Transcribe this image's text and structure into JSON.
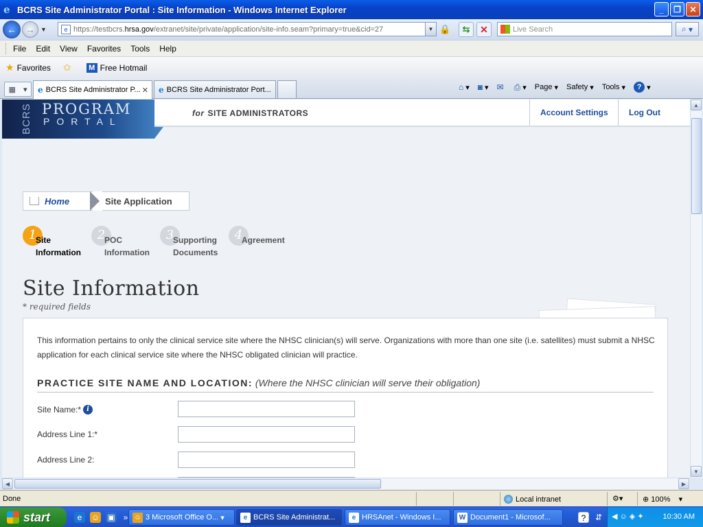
{
  "window": {
    "title": "BCRS Site Administrator Portal : Site Information - Windows Internet Explorer"
  },
  "address": {
    "url_prefix": "https://testbcrs.",
    "url_host": "hrsa.gov",
    "url_suffix": "/extranet/site/private/application/site-info.seam?primary=true&cid=27",
    "search_placeholder": "Live Search"
  },
  "menu": [
    "File",
    "Edit",
    "View",
    "Favorites",
    "Tools",
    "Help"
  ],
  "favorites": {
    "label": "Favorites",
    "hotmail": "Free Hotmail"
  },
  "tabs": [
    {
      "label": "BCRS Site Administrator P...",
      "active": true
    },
    {
      "label": "BCRS Site Administrator Port...",
      "active": false
    }
  ],
  "command_bar": {
    "page": "Page",
    "safety": "Safety",
    "tools": "Tools"
  },
  "header": {
    "logo_bcrs": "BCRS",
    "logo_program": "PROGRAM",
    "logo_portal": "PORTAL",
    "for_word": "for",
    "audience": "SITE ADMINISTRATORS",
    "account_settings": "Account Settings",
    "log_out": "Log Out"
  },
  "breadcrumb": {
    "home": "Home",
    "current": "Site Application"
  },
  "steps": [
    {
      "num": "1",
      "line1": "Site",
      "line2": "Information",
      "active": true
    },
    {
      "num": "2",
      "line1": "POC",
      "line2": "Information",
      "active": false
    },
    {
      "num": "3",
      "line1": "Supporting",
      "line2": "Documents",
      "active": false
    },
    {
      "num": "4",
      "line1": "Agreement",
      "line2": "",
      "active": false
    }
  ],
  "page": {
    "title": "Site Information",
    "required_note": "* required fields",
    "intro": "This information pertains to only the clinical service site where the NHSC clinician(s) will serve. Organizations with more than one site (i.e. satellites) must submit a NHSC application for each clinical service site where the NHSC obligated clinician will practice.",
    "section_title": "PRACTICE SITE NAME AND LOCATION:",
    "section_note": "(Where the NHSC clinician will serve their obligation)"
  },
  "form": {
    "site_name_label": "Site Name:*",
    "site_name_value": "",
    "address1_label": "Address Line 1:*",
    "address1_value": "",
    "address2_label": "Address Line 2:",
    "address2_value": ""
  },
  "status": {
    "text": "Done",
    "zone": "Local intranet",
    "zoom": "100%"
  },
  "taskbar": {
    "start": "start",
    "tasks": [
      "3 Microsoft Office O...",
      "BCRS Site Administrat...",
      "HRSAnet - Windows I...",
      "Document1 - Microsof..."
    ],
    "clock": "10:30 AM"
  }
}
